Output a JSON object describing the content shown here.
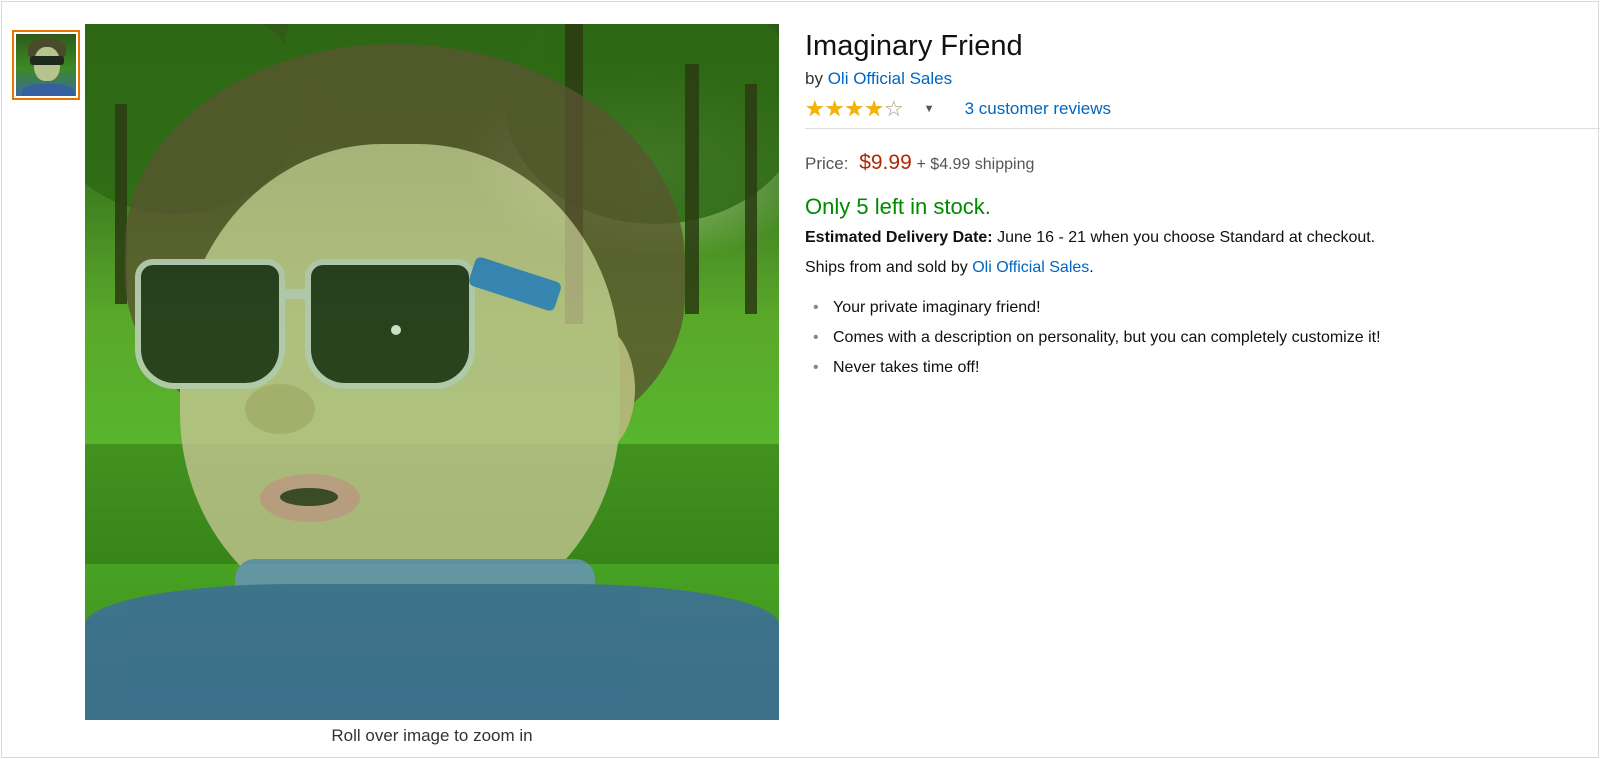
{
  "product": {
    "title": "Imaginary Friend",
    "by_prefix": "by",
    "seller": "Oli Official Sales",
    "rating": 4,
    "rating_max": 5,
    "reviews_link": "3 customer reviews",
    "price_label": "Price:",
    "price": "$9.99",
    "shipping": "+ $4.99 shipping",
    "stock": "Only 5 left in stock.",
    "delivery_label": "Estimated Delivery Date:",
    "delivery_text": "June 16 - 21 when you choose Standard at checkout.",
    "ships_prefix": "Ships from and sold by",
    "ships_seller": "Oli Official Sales",
    "ships_suffix": ".",
    "bullets": [
      "Your private imaginary friend!",
      "Comes with a description on personality, but you can completely customize it!",
      "Never takes time off!"
    ]
  },
  "image": {
    "zoom_caption": "Roll over image to zoom in"
  },
  "colors": {
    "link": "#0066c0",
    "price": "#b12704",
    "stock": "#008a00",
    "star": "#f4b400",
    "thumb_border": "#e77600"
  }
}
